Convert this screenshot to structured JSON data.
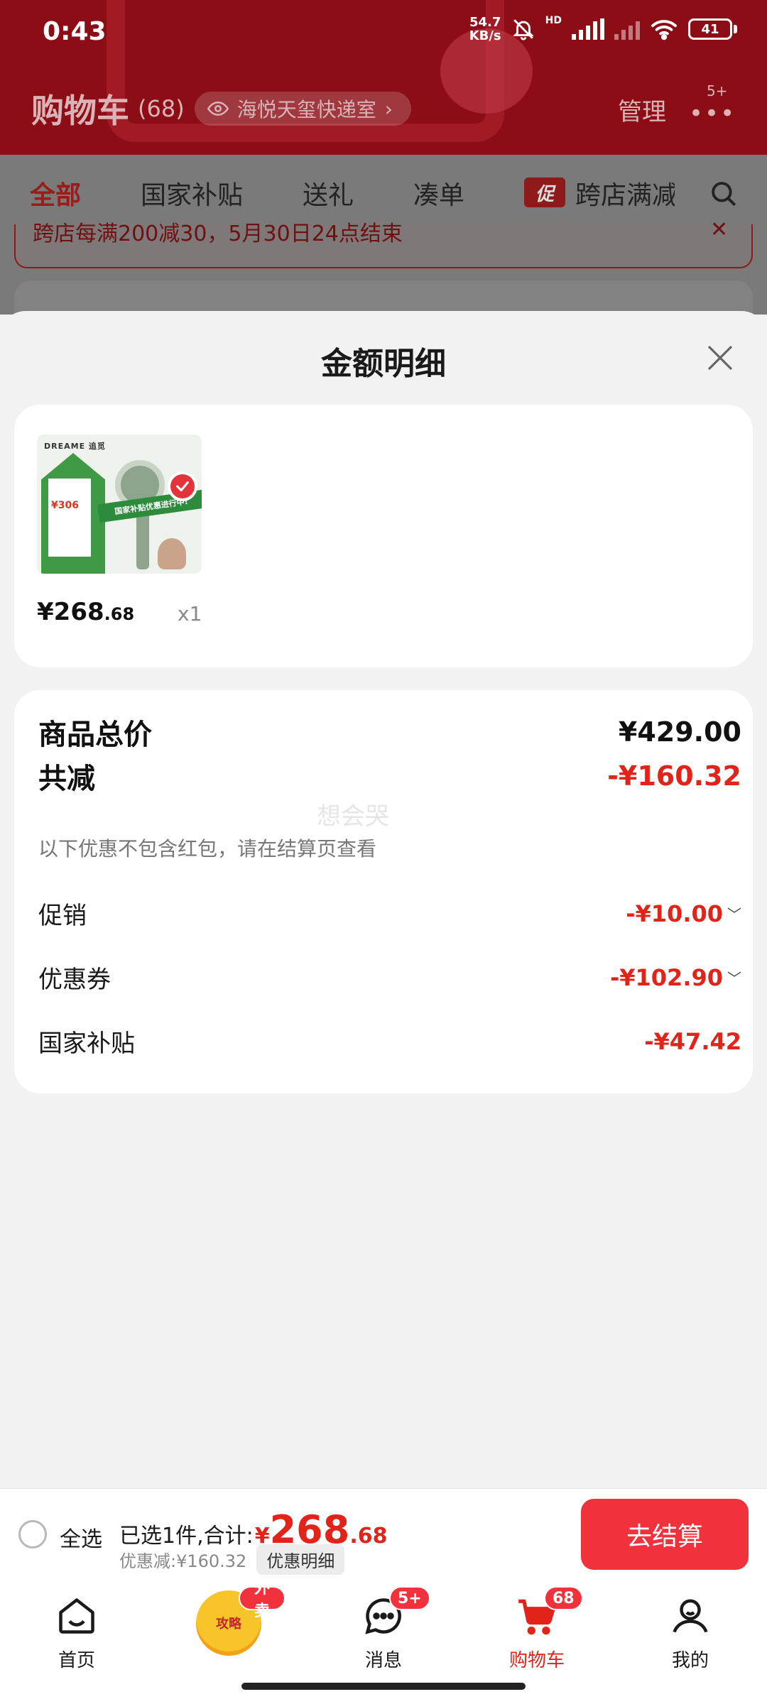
{
  "status_bar": {
    "time": "0:43",
    "net_speed_value": "54.7",
    "net_speed_unit": "KB/s",
    "hd": "HD",
    "battery": "41"
  },
  "header": {
    "title": "购物车",
    "count": "(68)",
    "address": "海悦天玺快递室",
    "manage": "管理",
    "more_badge": "5+"
  },
  "tabs": [
    {
      "label": "全部",
      "active": true
    },
    {
      "label": "国家补贴"
    },
    {
      "label": "送礼"
    },
    {
      "label": "凑单"
    },
    {
      "label": "跨店满减",
      "badge": "促"
    }
  ],
  "notice": {
    "text": "跨店每满200减30，5月30日24点结束"
  },
  "sheet": {
    "title": "金额明细",
    "product": {
      "image_brand": "DREAME 追觅",
      "image_banner": "国家补贴优惠进行中!",
      "image_price": "¥306",
      "price_int": "¥268",
      "price_dec": ".68",
      "qty": "x1"
    },
    "details": {
      "total_label": "商品总价",
      "total_value": "¥429.00",
      "reduction_label": "共减",
      "reduction_value": "-¥160.32",
      "note": "以下优惠不包含红包，请在结算页查看",
      "watermark": "想会哭",
      "items": [
        {
          "label": "促销",
          "value": "-¥10.00",
          "expandable": true
        },
        {
          "label": "优惠券",
          "value": "-¥102.90",
          "expandable": true
        },
        {
          "label": "国家补贴",
          "value": "-¥47.42",
          "expandable": false
        }
      ]
    }
  },
  "action_bar": {
    "select_all": "全选",
    "summary_label": "已选1件,合计:",
    "yen": "¥",
    "total_int": "268",
    "total_dec": ".68",
    "discount_text": "优惠减:¥160.32",
    "discount_chip": "优惠明细",
    "checkout": "去结算"
  },
  "tabbar": {
    "items": [
      {
        "label": "首页",
        "icon": "home-icon"
      },
      {
        "label": "",
        "icon": "promo-icon",
        "badge": "外卖",
        "inner": "攻略"
      },
      {
        "label": "消息",
        "icon": "message-icon",
        "badge": "5+"
      },
      {
        "label": "购物车",
        "icon": "cart-icon",
        "badge": "68",
        "active": true
      },
      {
        "label": "我的",
        "icon": "profile-icon"
      }
    ]
  },
  "colors": {
    "accent": "#e2231a",
    "header_bg": "#8c0d16",
    "checkout_bg": "#f1313b"
  }
}
